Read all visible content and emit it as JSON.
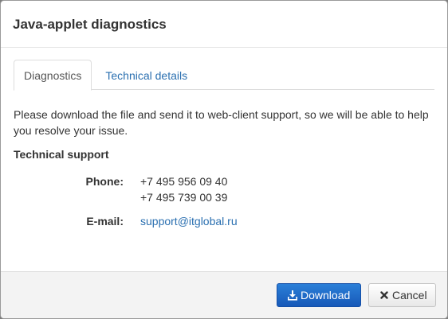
{
  "dialog": {
    "title": "Java-applet diagnostics"
  },
  "tabs": [
    {
      "label": "Diagnostics",
      "active": true
    },
    {
      "label": "Technical details",
      "active": false
    }
  ],
  "body": {
    "message": "Please download the file and send it to web-client support, so we will be able to help you resolve your issue.",
    "section_title": "Technical support",
    "phone_label": "Phone:",
    "phones": [
      "+7 495 956 09 40",
      "+7 495 739 00 39"
    ],
    "email_label": "E-mail:",
    "email": "support@itglobal.ru"
  },
  "footer": {
    "download_label": "Download",
    "download_icon": "download-icon",
    "cancel_label": "Cancel",
    "cancel_icon": "close-icon"
  },
  "colors": {
    "primary": "#1f6bc9",
    "link": "#2a6fb0"
  }
}
